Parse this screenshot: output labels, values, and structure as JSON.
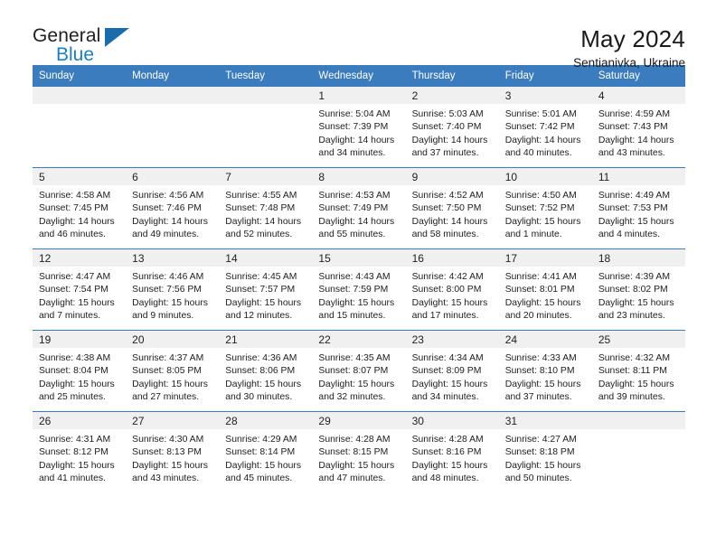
{
  "brand": {
    "name_top": "General",
    "name_bottom": "Blue",
    "accent_color": "#1b7fc4",
    "triangle_color": "#1b6cad",
    "triangle_icon": "triangle-icon"
  },
  "header": {
    "title": "May 2024",
    "subtitle": "Sentianivka, Ukraine"
  },
  "calendar": {
    "header_bg": "#3a7cbe",
    "header_text_color": "#ffffff",
    "daynum_bg": "#f0f0f0",
    "weekday_headers": [
      "Sunday",
      "Monday",
      "Tuesday",
      "Wednesday",
      "Thursday",
      "Friday",
      "Saturday"
    ],
    "weeks": [
      [
        {
          "day": "",
          "empty": true
        },
        {
          "day": "",
          "empty": true
        },
        {
          "day": "",
          "empty": true
        },
        {
          "day": "1",
          "sunrise": "Sunrise: 5:04 AM",
          "sunset": "Sunset: 7:39 PM",
          "daylight": "Daylight: 14 hours and 34 minutes."
        },
        {
          "day": "2",
          "sunrise": "Sunrise: 5:03 AM",
          "sunset": "Sunset: 7:40 PM",
          "daylight": "Daylight: 14 hours and 37 minutes."
        },
        {
          "day": "3",
          "sunrise": "Sunrise: 5:01 AM",
          "sunset": "Sunset: 7:42 PM",
          "daylight": "Daylight: 14 hours and 40 minutes."
        },
        {
          "day": "4",
          "sunrise": "Sunrise: 4:59 AM",
          "sunset": "Sunset: 7:43 PM",
          "daylight": "Daylight: 14 hours and 43 minutes."
        }
      ],
      [
        {
          "day": "5",
          "sunrise": "Sunrise: 4:58 AM",
          "sunset": "Sunset: 7:45 PM",
          "daylight": "Daylight: 14 hours and 46 minutes."
        },
        {
          "day": "6",
          "sunrise": "Sunrise: 4:56 AM",
          "sunset": "Sunset: 7:46 PM",
          "daylight": "Daylight: 14 hours and 49 minutes."
        },
        {
          "day": "7",
          "sunrise": "Sunrise: 4:55 AM",
          "sunset": "Sunset: 7:48 PM",
          "daylight": "Daylight: 14 hours and 52 minutes."
        },
        {
          "day": "8",
          "sunrise": "Sunrise: 4:53 AM",
          "sunset": "Sunset: 7:49 PM",
          "daylight": "Daylight: 14 hours and 55 minutes."
        },
        {
          "day": "9",
          "sunrise": "Sunrise: 4:52 AM",
          "sunset": "Sunset: 7:50 PM",
          "daylight": "Daylight: 14 hours and 58 minutes."
        },
        {
          "day": "10",
          "sunrise": "Sunrise: 4:50 AM",
          "sunset": "Sunset: 7:52 PM",
          "daylight": "Daylight: 15 hours and 1 minute."
        },
        {
          "day": "11",
          "sunrise": "Sunrise: 4:49 AM",
          "sunset": "Sunset: 7:53 PM",
          "daylight": "Daylight: 15 hours and 4 minutes."
        }
      ],
      [
        {
          "day": "12",
          "sunrise": "Sunrise: 4:47 AM",
          "sunset": "Sunset: 7:54 PM",
          "daylight": "Daylight: 15 hours and 7 minutes."
        },
        {
          "day": "13",
          "sunrise": "Sunrise: 4:46 AM",
          "sunset": "Sunset: 7:56 PM",
          "daylight": "Daylight: 15 hours and 9 minutes."
        },
        {
          "day": "14",
          "sunrise": "Sunrise: 4:45 AM",
          "sunset": "Sunset: 7:57 PM",
          "daylight": "Daylight: 15 hours and 12 minutes."
        },
        {
          "day": "15",
          "sunrise": "Sunrise: 4:43 AM",
          "sunset": "Sunset: 7:59 PM",
          "daylight": "Daylight: 15 hours and 15 minutes."
        },
        {
          "day": "16",
          "sunrise": "Sunrise: 4:42 AM",
          "sunset": "Sunset: 8:00 PM",
          "daylight": "Daylight: 15 hours and 17 minutes."
        },
        {
          "day": "17",
          "sunrise": "Sunrise: 4:41 AM",
          "sunset": "Sunset: 8:01 PM",
          "daylight": "Daylight: 15 hours and 20 minutes."
        },
        {
          "day": "18",
          "sunrise": "Sunrise: 4:39 AM",
          "sunset": "Sunset: 8:02 PM",
          "daylight": "Daylight: 15 hours and 23 minutes."
        }
      ],
      [
        {
          "day": "19",
          "sunrise": "Sunrise: 4:38 AM",
          "sunset": "Sunset: 8:04 PM",
          "daylight": "Daylight: 15 hours and 25 minutes."
        },
        {
          "day": "20",
          "sunrise": "Sunrise: 4:37 AM",
          "sunset": "Sunset: 8:05 PM",
          "daylight": "Daylight: 15 hours and 27 minutes."
        },
        {
          "day": "21",
          "sunrise": "Sunrise: 4:36 AM",
          "sunset": "Sunset: 8:06 PM",
          "daylight": "Daylight: 15 hours and 30 minutes."
        },
        {
          "day": "22",
          "sunrise": "Sunrise: 4:35 AM",
          "sunset": "Sunset: 8:07 PM",
          "daylight": "Daylight: 15 hours and 32 minutes."
        },
        {
          "day": "23",
          "sunrise": "Sunrise: 4:34 AM",
          "sunset": "Sunset: 8:09 PM",
          "daylight": "Daylight: 15 hours and 34 minutes."
        },
        {
          "day": "24",
          "sunrise": "Sunrise: 4:33 AM",
          "sunset": "Sunset: 8:10 PM",
          "daylight": "Daylight: 15 hours and 37 minutes."
        },
        {
          "day": "25",
          "sunrise": "Sunrise: 4:32 AM",
          "sunset": "Sunset: 8:11 PM",
          "daylight": "Daylight: 15 hours and 39 minutes."
        }
      ],
      [
        {
          "day": "26",
          "sunrise": "Sunrise: 4:31 AM",
          "sunset": "Sunset: 8:12 PM",
          "daylight": "Daylight: 15 hours and 41 minutes."
        },
        {
          "day": "27",
          "sunrise": "Sunrise: 4:30 AM",
          "sunset": "Sunset: 8:13 PM",
          "daylight": "Daylight: 15 hours and 43 minutes."
        },
        {
          "day": "28",
          "sunrise": "Sunrise: 4:29 AM",
          "sunset": "Sunset: 8:14 PM",
          "daylight": "Daylight: 15 hours and 45 minutes."
        },
        {
          "day": "29",
          "sunrise": "Sunrise: 4:28 AM",
          "sunset": "Sunset: 8:15 PM",
          "daylight": "Daylight: 15 hours and 47 minutes."
        },
        {
          "day": "30",
          "sunrise": "Sunrise: 4:28 AM",
          "sunset": "Sunset: 8:16 PM",
          "daylight": "Daylight: 15 hours and 48 minutes."
        },
        {
          "day": "31",
          "sunrise": "Sunrise: 4:27 AM",
          "sunset": "Sunset: 8:18 PM",
          "daylight": "Daylight: 15 hours and 50 minutes."
        },
        {
          "day": "",
          "empty": true
        }
      ]
    ]
  }
}
